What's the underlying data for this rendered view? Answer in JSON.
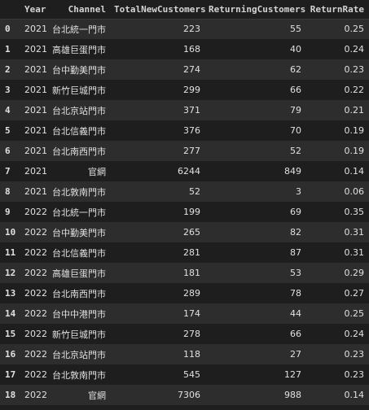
{
  "table": {
    "columns": [
      "",
      "Year",
      "Channel",
      "TotalNewCustomers",
      "ReturningCustomers",
      "ReturnRate"
    ],
    "rows": [
      {
        "index": "0",
        "year": "2021",
        "channel": "台北統一門市",
        "total_new": "223",
        "returning": "55",
        "return_rate": "0.25"
      },
      {
        "index": "1",
        "year": "2021",
        "channel": "高雄巨蛋門市",
        "total_new": "168",
        "returning": "40",
        "return_rate": "0.24"
      },
      {
        "index": "2",
        "year": "2021",
        "channel": "台中勤美門市",
        "total_new": "274",
        "returning": "62",
        "return_rate": "0.23"
      },
      {
        "index": "3",
        "year": "2021",
        "channel": "新竹巨城門市",
        "total_new": "299",
        "returning": "66",
        "return_rate": "0.22"
      },
      {
        "index": "4",
        "year": "2021",
        "channel": "台北京站門市",
        "total_new": "371",
        "returning": "79",
        "return_rate": "0.21"
      },
      {
        "index": "5",
        "year": "2021",
        "channel": "台北信義門市",
        "total_new": "376",
        "returning": "70",
        "return_rate": "0.19"
      },
      {
        "index": "6",
        "year": "2021",
        "channel": "台北南西門市",
        "total_new": "277",
        "returning": "52",
        "return_rate": "0.19"
      },
      {
        "index": "7",
        "year": "2021",
        "channel": "官網",
        "total_new": "6244",
        "returning": "849",
        "return_rate": "0.14"
      },
      {
        "index": "8",
        "year": "2021",
        "channel": "台北敦南門市",
        "total_new": "52",
        "returning": "3",
        "return_rate": "0.06"
      },
      {
        "index": "9",
        "year": "2022",
        "channel": "台北統一門市",
        "total_new": "199",
        "returning": "69",
        "return_rate": "0.35"
      },
      {
        "index": "10",
        "year": "2022",
        "channel": "台中勤美門市",
        "total_new": "265",
        "returning": "82",
        "return_rate": "0.31"
      },
      {
        "index": "11",
        "year": "2022",
        "channel": "台北信義門市",
        "total_new": "281",
        "returning": "87",
        "return_rate": "0.31"
      },
      {
        "index": "12",
        "year": "2022",
        "channel": "高雄巨蛋門市",
        "total_new": "181",
        "returning": "53",
        "return_rate": "0.29"
      },
      {
        "index": "13",
        "year": "2022",
        "channel": "台北南西門市",
        "total_new": "289",
        "returning": "78",
        "return_rate": "0.27"
      },
      {
        "index": "14",
        "year": "2022",
        "channel": "台中中港門市",
        "total_new": "174",
        "returning": "44",
        "return_rate": "0.25"
      },
      {
        "index": "15",
        "year": "2022",
        "channel": "新竹巨城門市",
        "total_new": "278",
        "returning": "66",
        "return_rate": "0.24"
      },
      {
        "index": "16",
        "year": "2022",
        "channel": "台北京站門市",
        "total_new": "118",
        "returning": "27",
        "return_rate": "0.23"
      },
      {
        "index": "17",
        "year": "2022",
        "channel": "台北敦南門市",
        "total_new": "545",
        "returning": "127",
        "return_rate": "0.23"
      },
      {
        "index": "18",
        "year": "2022",
        "channel": "官網",
        "total_new": "7306",
        "returning": "988",
        "return_rate": "0.14"
      }
    ]
  },
  "colors": {
    "background": "#1e1e1e",
    "row_stripe": "#2d2d2d",
    "text": "#e0e0e0"
  }
}
